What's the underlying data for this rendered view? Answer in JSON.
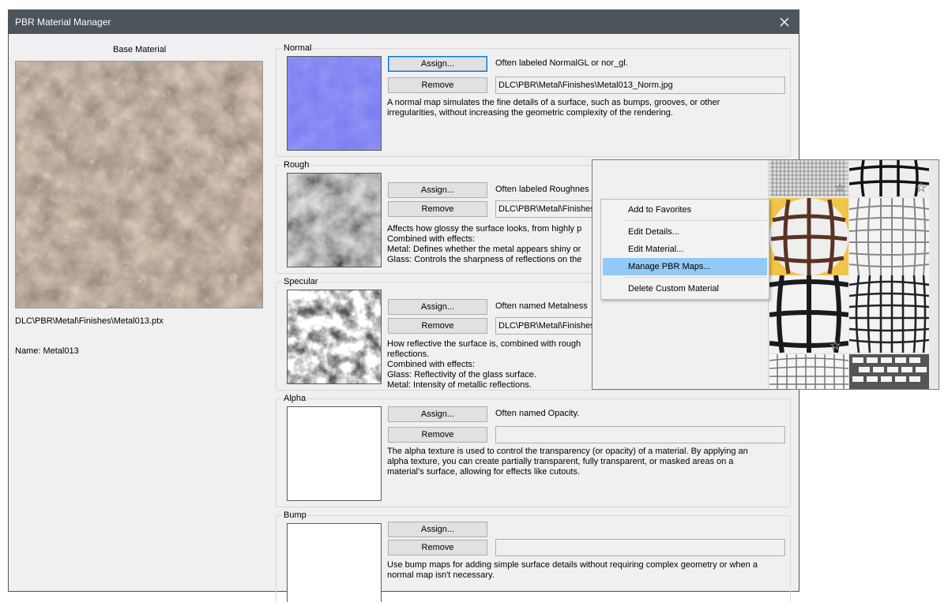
{
  "window": {
    "title": "PBR Material Manager"
  },
  "base": {
    "title": "Base Material",
    "path": "DLC\\PBR\\Metal\\Finishes\\Metal013.ptx",
    "name": "Name: Metal013"
  },
  "buttons": {
    "assign": "Assign...",
    "remove": "Remove"
  },
  "sections": {
    "normal": {
      "label": "Normal",
      "hint": "Often labeled NormalGL or nor_gl.",
      "path": "DLC\\PBR\\Metal\\Finishes\\Metal013_Norm.jpg",
      "desc": "A normal map simulates the fine details of a surface, such as bumps, grooves, or other\nirregularities, without increasing the geometric complexity of the rendering."
    },
    "rough": {
      "label": "Rough",
      "hint": "Often labeled Roughnes",
      "path": "DLC\\PBR\\Metal\\Finishes\\",
      "desc": "Affects how glossy the surface looks, from highly p\nCombined with effects:\nMetal: Defines whether the metal appears shiny or\nGlass: Controls the sharpness of reflections on the"
    },
    "specular": {
      "label": "Specular",
      "hint": "Often named Metalness",
      "path": "DLC\\PBR\\Metal\\Finishes\\",
      "desc": "How reflective the surface is, combined with rough\nreflections.\nCombined with effects:\nGlass: Reflectivity of the glass surface.\nMetal: Intensity of metallic reflections."
    },
    "alpha": {
      "label": "Alpha",
      "hint": "Often named Opacity.",
      "path": "",
      "desc": "The alpha texture is used to control the transparency (or opacity) of a material. By applying an\nalpha texture, you can create partially transparent, fully transparent, or masked areas on a\nmaterial's surface, allowing for effects like cutouts."
    },
    "bump": {
      "label": "Bump",
      "path": "",
      "desc": "Use bump maps for adding simple surface details without requiring complex geometry or when a\nnormal map isn't necessary."
    }
  },
  "context_menu": {
    "items": [
      "Add to Favorites",
      "Edit Details...",
      "Edit Material...",
      "Manage PBR Maps...",
      "Delete Custom Material"
    ],
    "highlighted": "Manage PBR Maps..."
  },
  "colors": {
    "titlebar": "#4c5559",
    "highlight": "#91c9f7",
    "normal_map": "#7a7cf0"
  }
}
